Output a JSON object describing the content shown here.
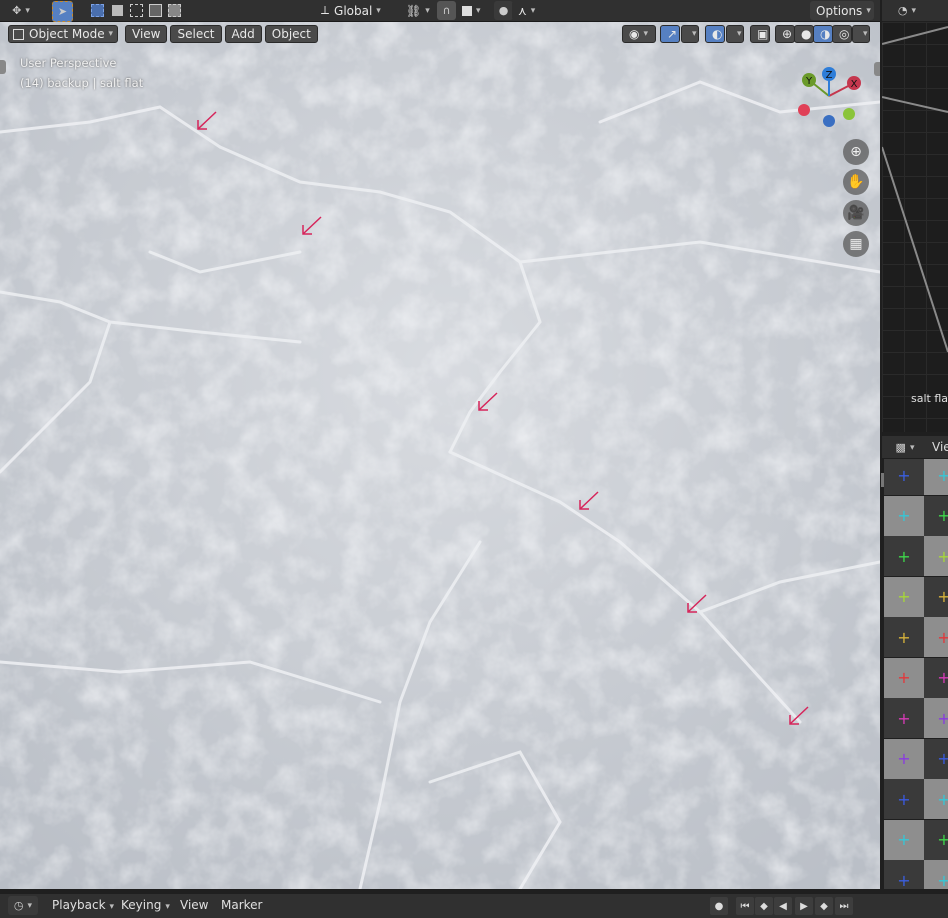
{
  "topbar": {
    "transform_orientation": "Global",
    "options_label": "Options"
  },
  "viewport": {
    "mode_label": "Object Mode",
    "menu": [
      "View",
      "Select",
      "Add",
      "Object"
    ],
    "overlay_line1": "User Perspective",
    "overlay_line2": "(14) backup | salt flat",
    "axes": {
      "x": "X",
      "y": "Y",
      "z": "Z"
    },
    "accent_arrow_color": "#d6245a"
  },
  "node_editor": {
    "node_label": "salt flat"
  },
  "image_editor": {
    "view_label": "Vie"
  },
  "timeline": {
    "playback_label": "Playback",
    "keying_label": "Keying",
    "view_label": "View",
    "marker_label": "Marker"
  }
}
